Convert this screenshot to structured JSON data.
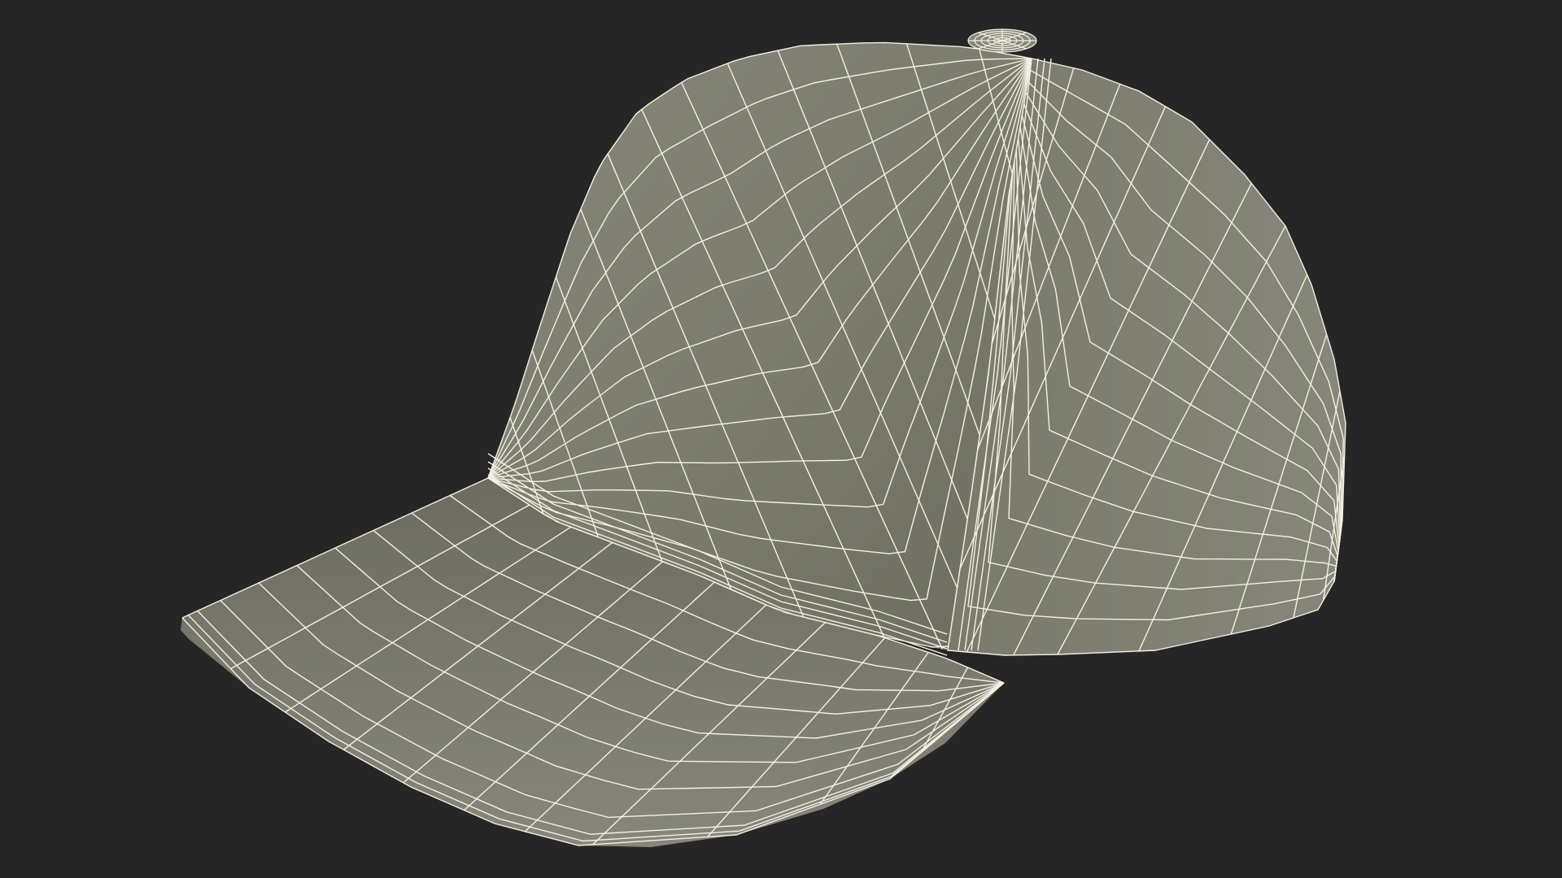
{
  "scene": {
    "subject_icon": "baseball-cap-wireframe-icon",
    "colors": {
      "background": "#262626",
      "surface": "#797a6c",
      "surface_dark": "#6b6c5f",
      "surface_light": "#86877a",
      "wire": "#f3f1e4"
    }
  }
}
